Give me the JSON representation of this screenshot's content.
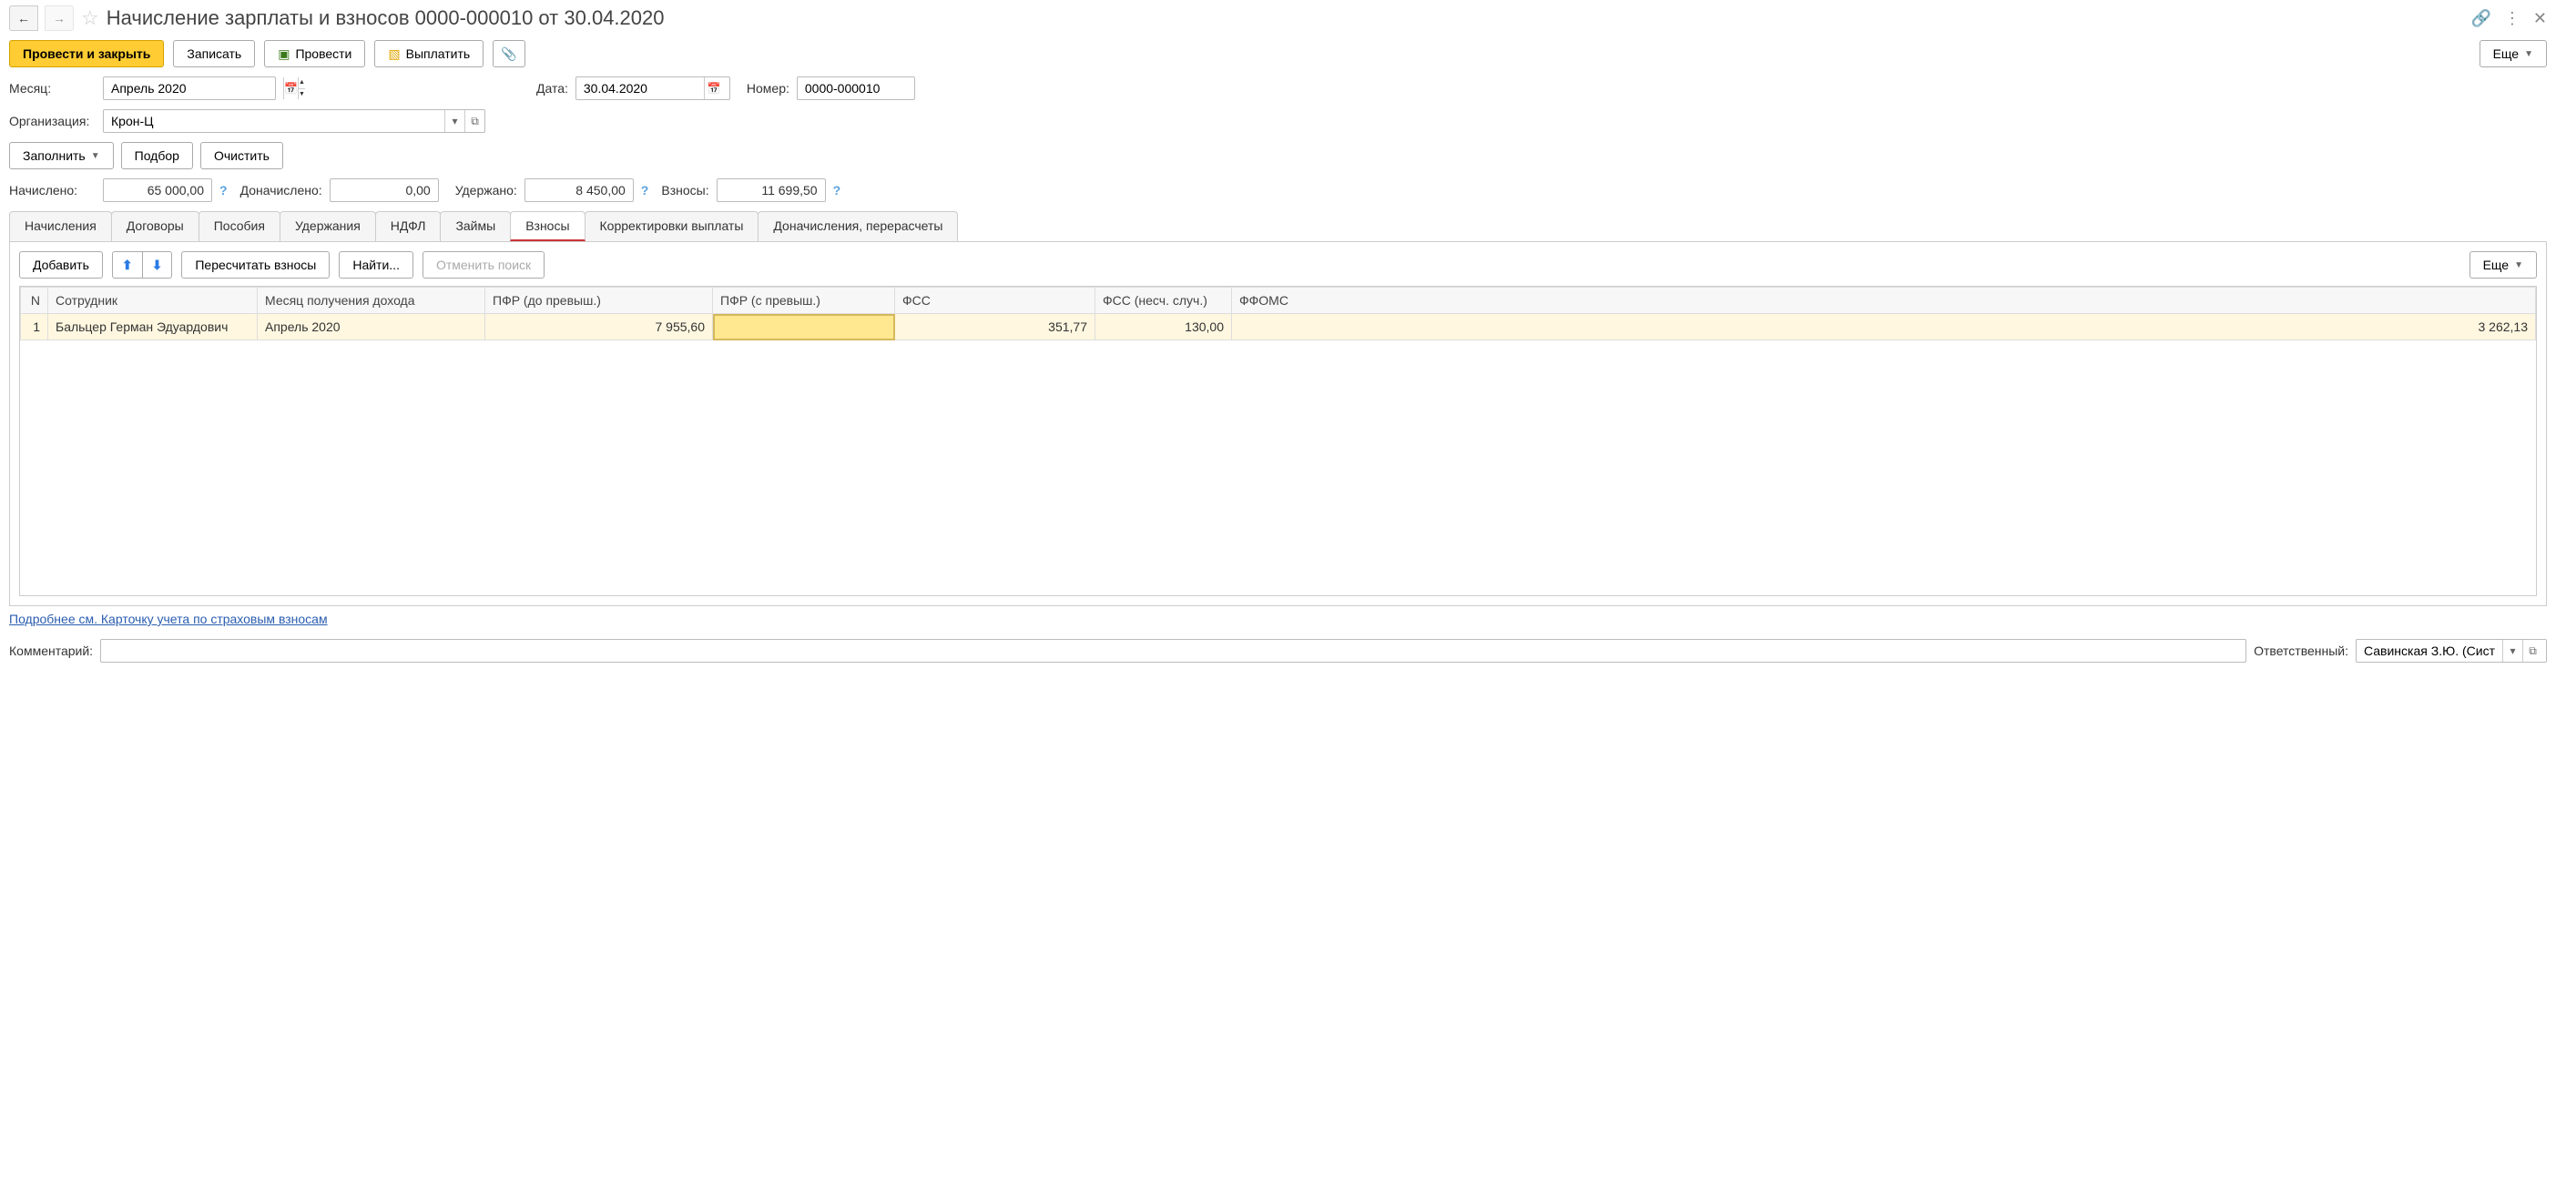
{
  "header": {
    "title": "Начисление зарплаты и взносов 0000-000010 от 30.04.2020"
  },
  "toolbar": {
    "post_close": "Провести и закрыть",
    "save": "Записать",
    "post": "Провести",
    "pay": "Выплатить",
    "more": "Еще"
  },
  "form": {
    "month_label": "Месяц:",
    "month_value": "Апрель 2020",
    "date_label": "Дата:",
    "date_value": "30.04.2020",
    "number_label": "Номер:",
    "number_value": "0000-000010",
    "org_label": "Организация:",
    "org_value": "Крон-Ц",
    "fill": "Заполнить",
    "pick": "Подбор",
    "clear": "Очистить",
    "accrued_label": "Начислено:",
    "accrued_value": "65 000,00",
    "addl_label": "Доначислено:",
    "addl_value": "0,00",
    "withheld_label": "Удержано:",
    "withheld_value": "8 450,00",
    "contrib_label": "Взносы:",
    "contrib_value": "11 699,50"
  },
  "tabs": {
    "items": [
      "Начисления",
      "Договоры",
      "Пособия",
      "Удержания",
      "НДФЛ",
      "Займы",
      "Взносы",
      "Корректировки выплаты",
      "Доначисления, перерасчеты"
    ]
  },
  "inner": {
    "add": "Добавить",
    "recalc": "Пересчитать взносы",
    "find": "Найти...",
    "cancel_search": "Отменить поиск",
    "more": "Еще"
  },
  "table": {
    "headers": {
      "n": "N",
      "employee": "Сотрудник",
      "income_month": "Месяц получения дохода",
      "pfr_below": "ПФР (до превыш.)",
      "pfr_above": "ПФР (с превыш.)",
      "fss": "ФСС",
      "fss_accident": "ФСС (несч. случ.)",
      "ffoms": "ФФОМС"
    },
    "rows": [
      {
        "n": "1",
        "employee": "Бальцер Герман Эдуардович",
        "income_month": "Апрель 2020",
        "pfr_below": "7 955,60",
        "pfr_above": "",
        "fss": "351,77",
        "fss_accident": "130,00",
        "ffoms": "3 262,13"
      }
    ]
  },
  "link": "Подробнее см. Карточку учета по страховым взносам",
  "footer": {
    "comment_label": "Комментарий:",
    "comment_value": "",
    "responsible_label": "Ответственный:",
    "responsible_value": "Савинская З.Ю. (Систем"
  }
}
